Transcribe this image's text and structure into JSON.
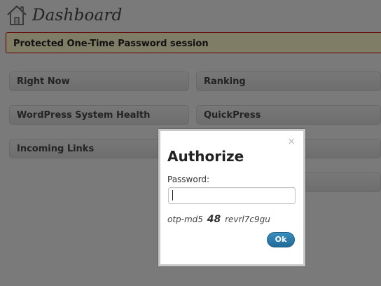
{
  "header": {
    "title": "Dashboard",
    "icon": "house-icon"
  },
  "notice": {
    "text": "Protected One-Time Password session",
    "border_color": "#cc0000",
    "background": "#fffbcc"
  },
  "widgets": {
    "left": [
      "Right Now",
      "WordPress System Health",
      "Incoming Links"
    ],
    "right": [
      "Ranking",
      "QuickPress"
    ]
  },
  "dialog": {
    "title": "Authorize",
    "close_glyph": "×",
    "password_label": "Password:",
    "password_value": "",
    "otp_prefix": "otp-md5",
    "otp_sequence": "48",
    "otp_seed": "revrl7c9gu",
    "ok_label": "Ok",
    "ok_color": "#2a7cb0"
  }
}
